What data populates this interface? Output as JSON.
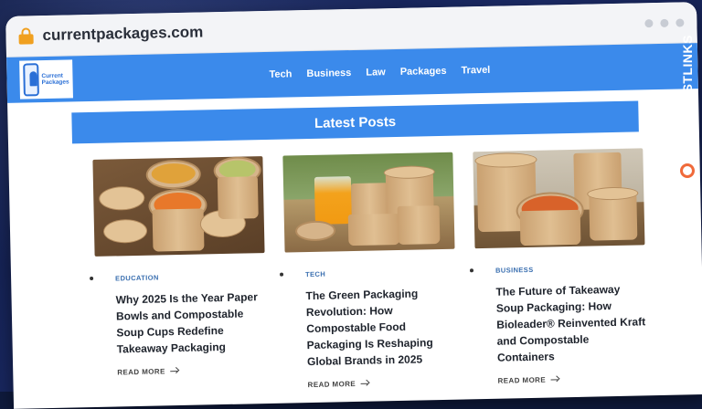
{
  "browser": {
    "url": "currentpackages.com"
  },
  "site": {
    "logo_text_line1": "Current",
    "logo_text_line2": "Packages",
    "nav": [
      "Tech",
      "Business",
      "Law",
      "Packages",
      "Travel"
    ],
    "section_title": "Latest Posts"
  },
  "posts": [
    {
      "category": "EDUCATION",
      "title": "Why 2025 Is the Year Paper Bowls and Compostable Soup Cups Redefine Takeaway Packaging",
      "cta": "READ MORE"
    },
    {
      "category": "TECH",
      "title": "The Green Packaging Revolution: How Compostable Food Packaging Is Reshaping Global Brands in 2025",
      "cta": "READ MORE"
    },
    {
      "category": "BUSINESS",
      "title": "The Future of Takeaway Soup Packaging: How Bioleader® Reinvented Kraft and Compostable Containers",
      "cta": "READ MORE"
    }
  ],
  "watermark": {
    "text": "GUESTPOSTLINKS"
  },
  "colors": {
    "nav_blue": "#3b8aeb",
    "accent_orange": "#f06a3a",
    "lock_yellow": "#f0a020"
  }
}
